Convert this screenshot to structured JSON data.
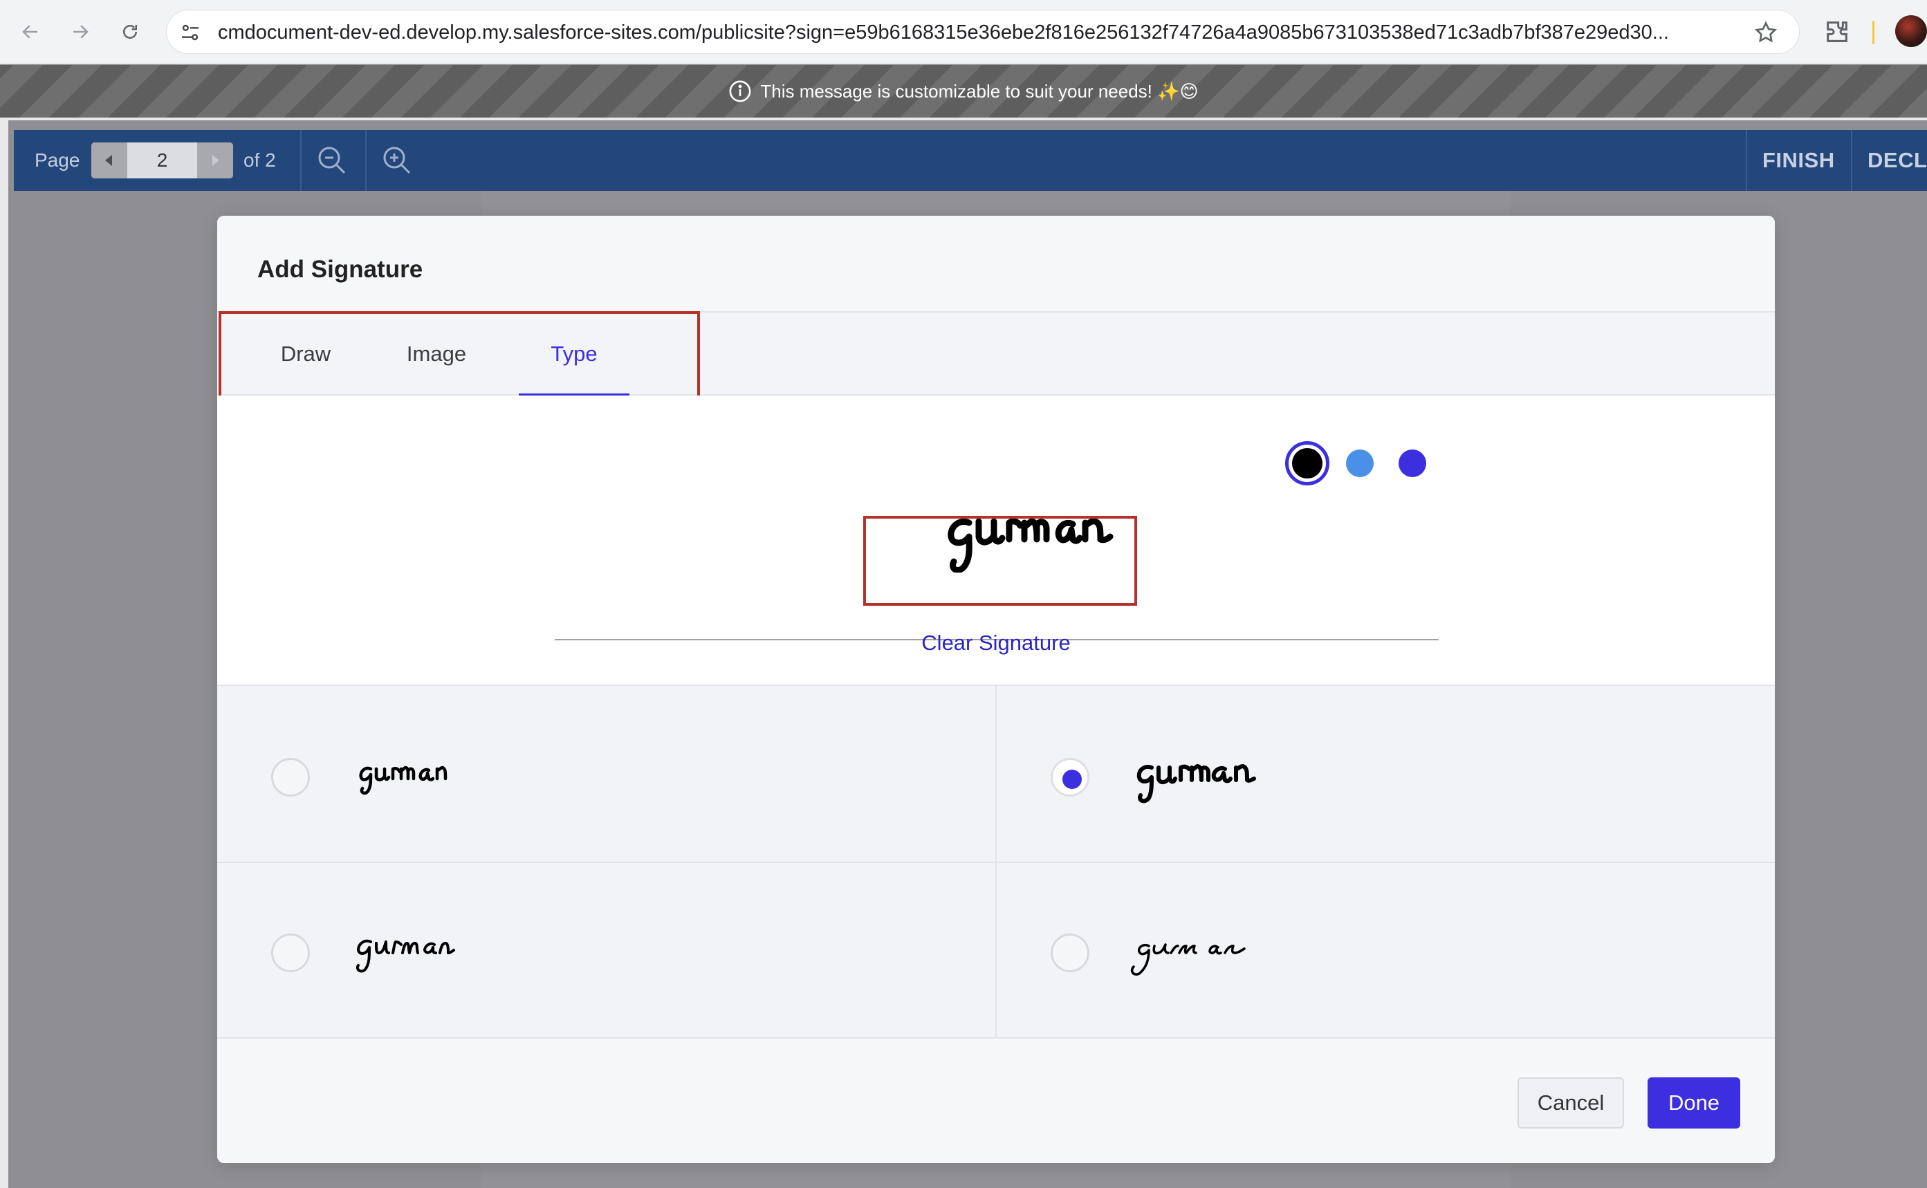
{
  "browser": {
    "url": "cmdocument-dev-ed.develop.my.salesforce-sites.com/publicsite?sign=e59b6168315e36ebe2f816e256132f74726a4a9085b673103538ed71c3adb7bf387e29ed30..."
  },
  "banner": {
    "message": "This message is customizable to suit your needs! ✨😊"
  },
  "viewer": {
    "page_label": "Page",
    "current_page": "2",
    "page_of": "of 2",
    "finish_label": "FINISH",
    "decline_label": "DECL"
  },
  "modal": {
    "title": "Add Signature",
    "tabs": [
      {
        "label": "Draw",
        "active": false
      },
      {
        "label": "Image",
        "active": false
      },
      {
        "label": "Type",
        "active": true
      }
    ],
    "ink_colors": [
      {
        "name": "black",
        "hex": "#000000",
        "selected": true
      },
      {
        "name": "light-blue",
        "hex": "#4a90e8",
        "selected": false
      },
      {
        "name": "indigo",
        "hex": "#3b2fe0",
        "selected": false
      }
    ],
    "typed_signature": "gurman",
    "clear_label": "Clear Signature",
    "font_options": [
      {
        "text": "gurman",
        "selected": false
      },
      {
        "text": "gurman",
        "selected": true
      },
      {
        "text": "gurman",
        "selected": false
      },
      {
        "text": "gurman",
        "selected": false
      }
    ],
    "cancel_label": "Cancel",
    "done_label": "Done"
  },
  "colors": {
    "accent": "#3b2fe0",
    "toolbar": "#23477a",
    "highlight": "#b3322a"
  }
}
